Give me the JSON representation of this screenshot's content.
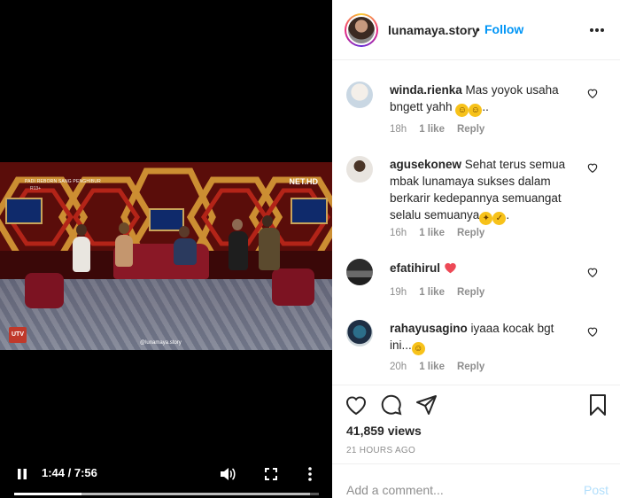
{
  "video": {
    "overlay_title": "PADI REBORN SANG PENGHIBUR",
    "overlay_rating": "R13+",
    "channel_logo": "NET.HD",
    "corner_logo": "UTV",
    "watermark": "@lunamaya.story",
    "current_time": "1:44",
    "separator": " / ",
    "duration": "7:56",
    "progress": 0.22,
    "buffered": 0.97
  },
  "header": {
    "username": "lunamaya.story",
    "dot": "•",
    "follow_label": "Follow",
    "more_icon": "ellipsis-icon"
  },
  "comments": [
    {
      "user": "winda.rienka",
      "text": "Mas yoyok usaha bngett yahh",
      "emoji": [
        "rofl",
        "rofl"
      ],
      "trail": "..",
      "time": "18h",
      "likes": "1 like",
      "reply": "Reply"
    },
    {
      "user": "agusekonew",
      "text": "Sehat terus semua mbak lunamaya sukses dalam berkarir kedepannya semuangat selalu semuanya",
      "emoji": [
        "flexed-biceps",
        "thumbs-up"
      ],
      "trail": ".",
      "time": "16h",
      "likes": "1 like",
      "reply": "Reply"
    },
    {
      "user": "efatihirul",
      "text": "",
      "emoji": [
        "red-heart"
      ],
      "trail": "",
      "time": "19h",
      "likes": "1 like",
      "reply": "Reply"
    },
    {
      "user": "rahayusagino",
      "text": "iyaaa kocak bgt ini...",
      "emoji": [
        "grinning-sweat"
      ],
      "trail": "",
      "time": "20h",
      "likes": "1 like",
      "reply": "Reply"
    }
  ],
  "actions": {
    "icons": [
      "heart-icon",
      "comment-icon",
      "share-icon",
      "bookmark-icon"
    ]
  },
  "stats": {
    "views": "41,859 views",
    "posted": "21 HOURS AGO"
  },
  "composer": {
    "placeholder": "Add a comment...",
    "post_label": "Post"
  },
  "colors": {
    "link": "#0095f6",
    "post_disabled": "#b2dffc",
    "muted": "#8e8e8e",
    "text": "#262626"
  }
}
